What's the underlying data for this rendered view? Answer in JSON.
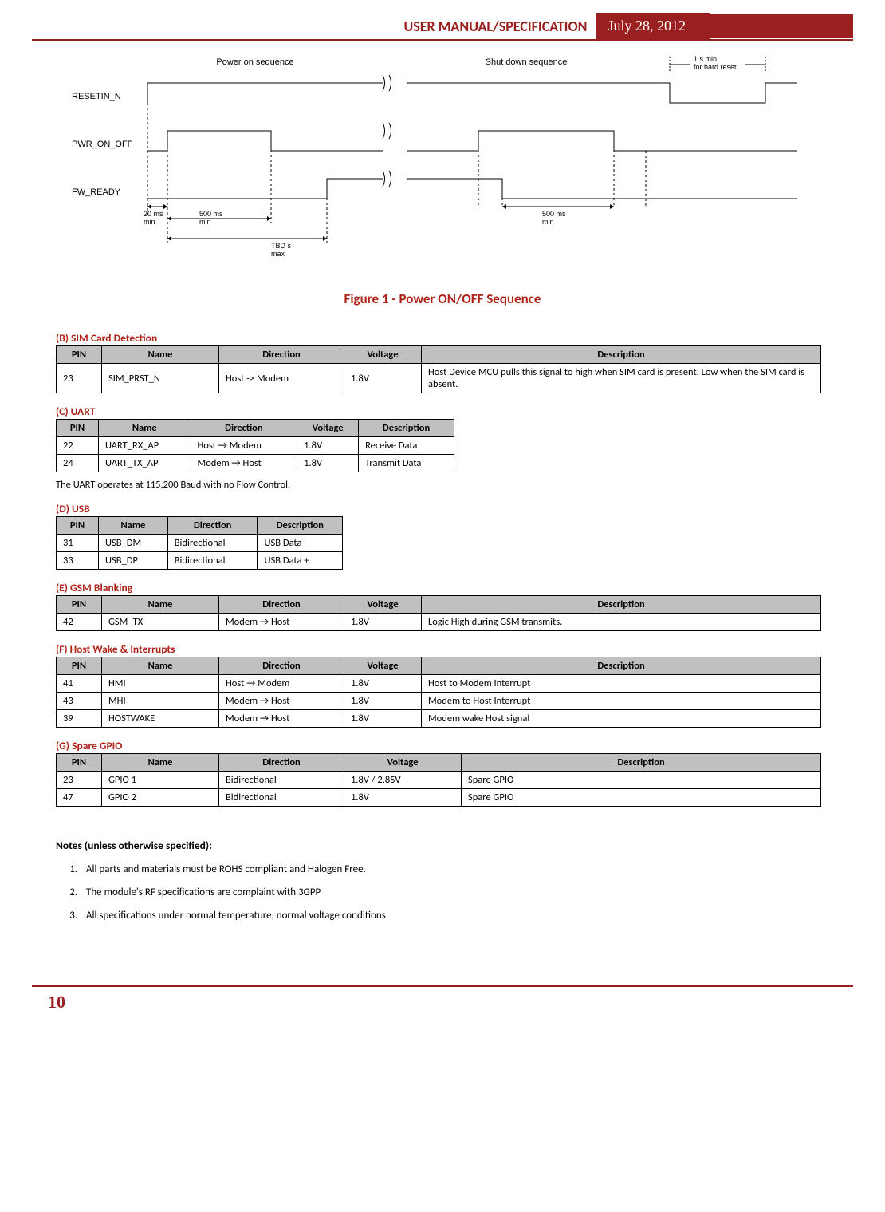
{
  "header": {
    "title": "USER MANUAL/SPECIFICATION",
    "date": "July 28, 2012"
  },
  "diagram": {
    "power_on": "Power on sequence",
    "shutdown": "Shut down sequence",
    "hard_reset": "1 s min\nfor hard reset",
    "signals": {
      "reset": "RESETIN_N",
      "pwr": "PWR_ON_OFF",
      "fw": "FW_READY"
    },
    "timings": {
      "t20": "20 ms\nmin",
      "t500a": "500 ms\nmin",
      "tbd": "TBD s\nmax",
      "t500b": "500 ms\nmin"
    }
  },
  "figure_caption": "Figure 1 - Power ON/OFF Sequence",
  "sections": {
    "b": {
      "title": "(B)  SIM Card Detection",
      "headers": [
        "PIN",
        "Name",
        "Direction",
        "Voltage",
        "Description"
      ],
      "rows": [
        {
          "pin": "23",
          "name": "SIM_PRST_N",
          "dir": "Host -> Modem",
          "volt": "1.8V",
          "desc": "Host Device MCU pulls this signal to high when SIM card is present.  Low when the SIM card is absent."
        }
      ]
    },
    "c": {
      "title": "(C)  UART",
      "headers": [
        "PIN",
        "Name",
        "Direction",
        "Voltage",
        "Description"
      ],
      "rows": [
        {
          "pin": "22",
          "name": "UART_RX_AP",
          "dir": "Host → Modem",
          "volt": "1.8V",
          "desc": "Receive Data"
        },
        {
          "pin": "24",
          "name": "UART_TX_AP",
          "dir": "Modem → Host",
          "volt": "1.8V",
          "desc": "Transmit Data"
        }
      ],
      "note": "The UART operates at 115,200 Baud with no Flow Control."
    },
    "d": {
      "title": "(D)  USB",
      "headers": [
        "PIN",
        "Name",
        "Direction",
        "Description"
      ],
      "rows": [
        {
          "pin": "31",
          "name": "USB_DM",
          "dir": "Bidirectional",
          "desc": "USB Data -"
        },
        {
          "pin": "33",
          "name": "USB_DP",
          "dir": "Bidirectional",
          "desc": "USB Data +"
        }
      ]
    },
    "e": {
      "title": "(E)  GSM Blanking",
      "headers": [
        "PIN",
        "Name",
        "Direction",
        "Voltage",
        "Description"
      ],
      "rows": [
        {
          "pin": "42",
          "name": "GSM_TX",
          "dir": "Modem → Host",
          "volt": "1.8V",
          "desc": "Logic High during GSM transmits."
        }
      ]
    },
    "f": {
      "title": "(F)  Host Wake & Interrupts",
      "headers": [
        "PIN",
        "Name",
        "Direction",
        "Voltage",
        "Description"
      ],
      "rows": [
        {
          "pin": "41",
          "name": "HMI",
          "dir": "Host → Modem",
          "volt": "1.8V",
          "desc": "Host to Modem Interrupt"
        },
        {
          "pin": "43",
          "name": "MHI",
          "dir": "Modem → Host",
          "volt": "1.8V",
          "desc": "Modem to Host Interrupt"
        },
        {
          "pin": "39",
          "name": "HOSTWAKE",
          "dir": "Modem → Host",
          "volt": "1.8V",
          "desc": "Modem wake Host signal"
        }
      ]
    },
    "g": {
      "title": "(G)  Spare GPIO",
      "headers": [
        "PIN",
        "Name",
        "Direction",
        "Voltage",
        "Description"
      ],
      "rows": [
        {
          "pin": "23",
          "name": "GPIO 1",
          "dir": "Bidirectional",
          "volt": "1.8V / 2.85V",
          "desc": "Spare GPIO"
        },
        {
          "pin": "47",
          "name": "GPIO 2",
          "dir": "Bidirectional",
          "volt": "1.8V",
          "desc": "Spare GPIO"
        }
      ]
    }
  },
  "notes": {
    "heading": "Notes (unless otherwise specified):",
    "items": [
      "All parts and materials must be ROHS compliant and Halogen Free.",
      "The module's RF specifications are complaint with 3GPP",
      "All specifications under normal temperature, normal voltage conditions"
    ]
  },
  "page_number": "10"
}
